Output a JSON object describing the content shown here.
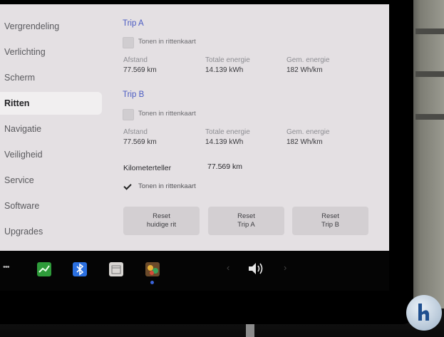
{
  "sidebar": {
    "items": [
      {
        "label": "Vergrendeling",
        "active": false
      },
      {
        "label": "Verlichting",
        "active": false
      },
      {
        "label": "Scherm",
        "active": false
      },
      {
        "label": "Ritten",
        "active": true
      },
      {
        "label": "Navigatie",
        "active": false
      },
      {
        "label": "Veiligheid",
        "active": false
      },
      {
        "label": "Service",
        "active": false
      },
      {
        "label": "Software",
        "active": false
      },
      {
        "label": "Upgrades",
        "active": false
      }
    ]
  },
  "trip_a": {
    "title": "Trip A",
    "show_on_map_label": "Tonen in rittenkaart",
    "show_on_map_checked": false,
    "distance_label": "Afstand",
    "distance_value": "77.569 km",
    "total_energy_label": "Totale energie",
    "total_energy_value": "14.139 kWh",
    "avg_energy_label": "Gem. energie",
    "avg_energy_value": "182 Wh/km"
  },
  "trip_b": {
    "title": "Trip B",
    "show_on_map_label": "Tonen in rittenkaart",
    "show_on_map_checked": false,
    "distance_label": "Afstand",
    "distance_value": "77.569 km",
    "total_energy_label": "Totale energie",
    "total_energy_value": "14.139 kWh",
    "avg_energy_label": "Gem. energie",
    "avg_energy_value": "182 Wh/km"
  },
  "odometer": {
    "label": "Kilometerteller",
    "value": "77.569 km",
    "show_on_map_label": "Tonen in rittenkaart",
    "show_on_map_checked": true
  },
  "buttons": {
    "reset_current_line1": "Reset",
    "reset_current_line2": "huidige rit",
    "reset_a_line1": "Reset",
    "reset_a_line2": "Trip A",
    "reset_b_line1": "Reset",
    "reset_b_line2": "Trip B"
  },
  "taskbar": {
    "icons": [
      "more-dots-icon",
      "energy-graph-icon",
      "bluetooth-icon",
      "calendar-icon",
      "toybox-icon",
      "chevron-left-icon",
      "volume-icon",
      "chevron-right-icon"
    ],
    "colors": {
      "energy": "#2e9b3a",
      "bluetooth": "#2a6fe0",
      "active_dot": "#3a63d8",
      "accent_title": "#4a5bc2"
    }
  }
}
